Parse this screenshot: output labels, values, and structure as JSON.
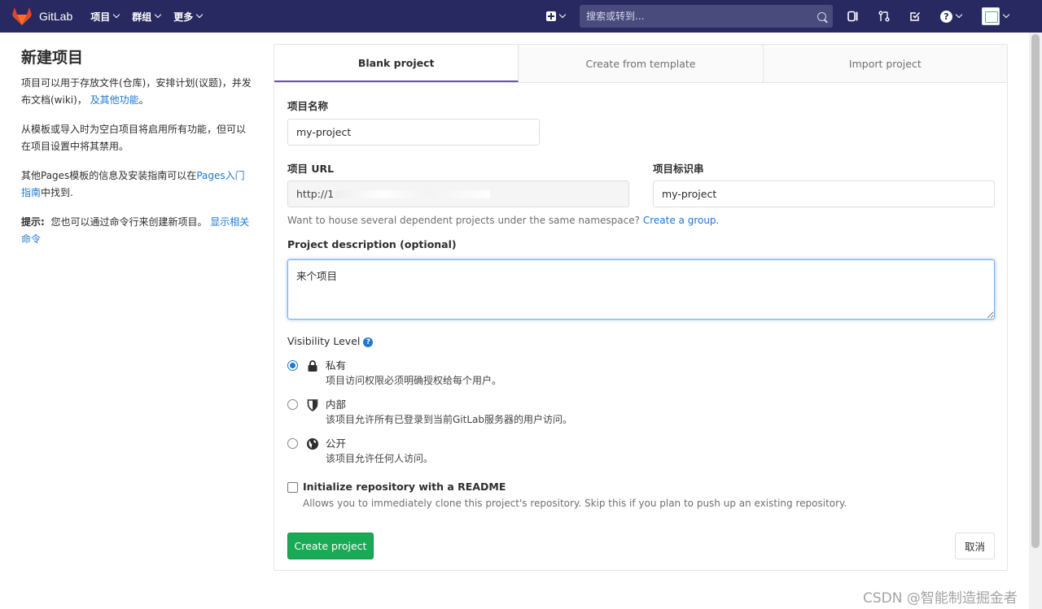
{
  "nav": {
    "brand": "GitLab",
    "menu": [
      {
        "label": "项目"
      },
      {
        "label": "群组"
      },
      {
        "label": "更多"
      }
    ],
    "search_placeholder": "搜索或转到...",
    "help_glyph": "?"
  },
  "sidebar": {
    "title": "新建项目",
    "p1_text": "项目可以用于存放文件(仓库)，安排计划(议题)，并发布文档(wiki)，",
    "p1_link": "及其他功能",
    "p1_end": "。",
    "p2_text": "从模板或导入时为空白项目将启用所有功能，但可以在项目设置中将其禁用。",
    "p3_text": "其他Pages模板的信息及安装指南可以在",
    "p3_link": "Pages入门指南",
    "p3_end": "中找到.",
    "tip_label": "提示:",
    "tip_text": "您也可以通过命令行来创建新项目。",
    "tip_link": "显示相关命令"
  },
  "tabs": [
    {
      "label": "Blank project",
      "active": true
    },
    {
      "label": "Create from template",
      "active": false
    },
    {
      "label": "Import project",
      "active": false
    }
  ],
  "form": {
    "name_label": "项目名称",
    "name_value": "my-project",
    "url_label": "项目 URL",
    "url_value": "http://1",
    "slug_label": "项目标识串",
    "slug_value": "my-project",
    "group_hint": "Want to house several dependent projects under the same namespace?",
    "group_link": "Create a group.",
    "desc_label": "Project description (optional)",
    "desc_value": "来个项目",
    "visibility_label": "Visibility Level",
    "visibility_help_glyph": "?",
    "visibility_options": [
      {
        "title": "私有",
        "desc": "项目访问权限必须明确授权给每个用户。",
        "icon": "lock-icon",
        "selected": true
      },
      {
        "title": "内部",
        "desc": "该项目允许所有已登录到当前GitLab服务器的用户访问。",
        "icon": "shield-icon",
        "selected": false
      },
      {
        "title": "公开",
        "desc": "该项目允许任何人访问。",
        "icon": "globe-icon",
        "selected": false
      }
    ],
    "readme_label": "Initialize repository with a README",
    "readme_desc": "Allows you to immediately clone this project's repository. Skip this if you plan to push up an existing repository.",
    "readme_checked": false,
    "create_button": "Create project",
    "cancel_button": "取消"
  },
  "watermark": "CSDN @智能制造掘金者",
  "colors": {
    "navbar": "#292961",
    "accent": "#1f78d1",
    "create_button": "#1aaa55",
    "active_tab_border": "#6b4fbb"
  }
}
